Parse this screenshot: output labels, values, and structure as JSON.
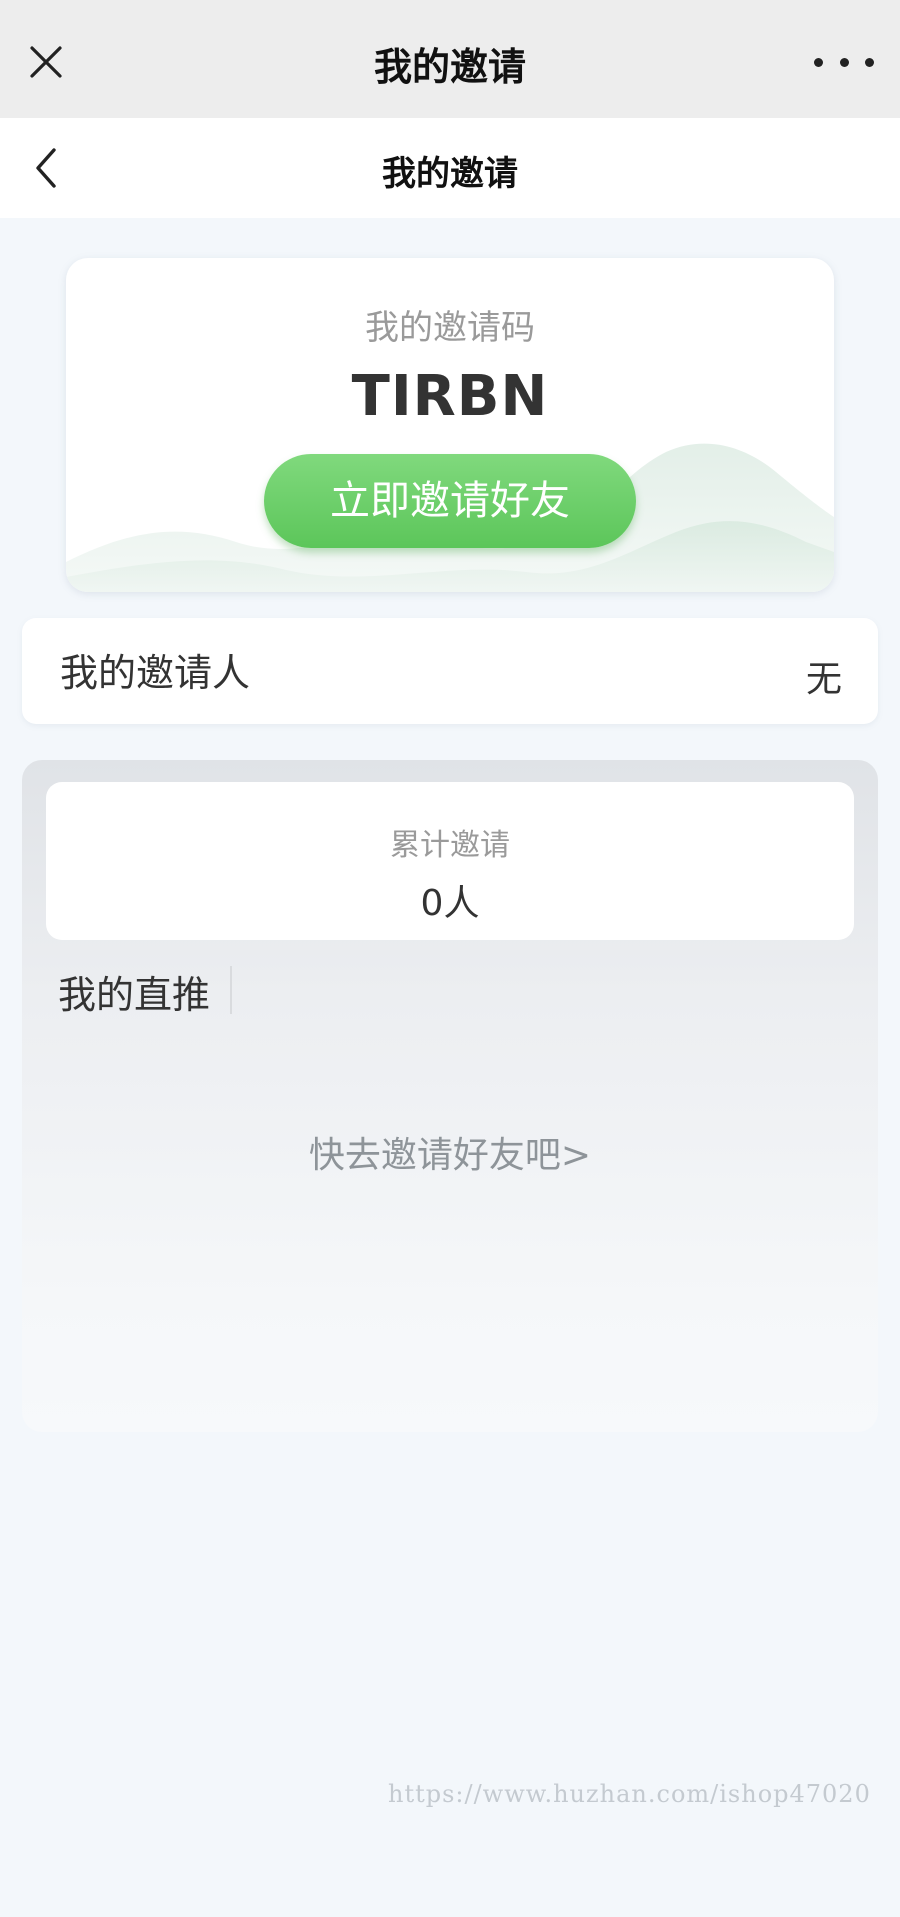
{
  "wechat_bar": {
    "title": "我的邀请"
  },
  "nav_bar": {
    "title": "我的邀请"
  },
  "invite_code_card": {
    "label": "我的邀请码",
    "code": "TIRBN",
    "button_label": "立即邀请好友"
  },
  "inviter_row": {
    "label": "我的邀请人",
    "value": "无"
  },
  "stats": {
    "total_label": "累计邀请",
    "total_value": "0人",
    "direct_title": "我的直推",
    "empty_prompt": "快去邀请好友吧>"
  },
  "watermark": "https://www.huzhan.com/ishop47020",
  "colors": {
    "primary_green": "#5cc65a",
    "page_background": "#f3f7fb",
    "wechat_bar": "#ededed"
  },
  "icons": [
    "close-icon",
    "more-icon",
    "back-icon"
  ]
}
